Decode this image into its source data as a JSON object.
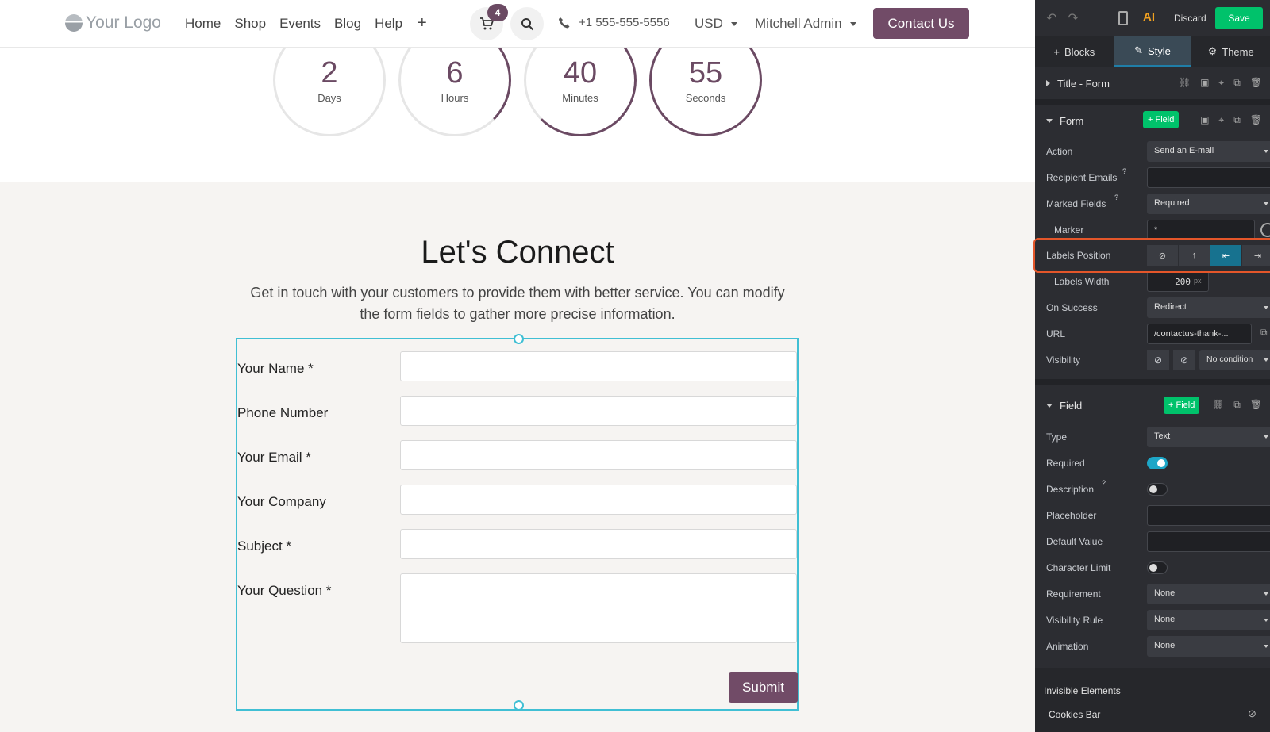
{
  "nav": {
    "logo": "Your Logo",
    "links": [
      "Home",
      "Shop",
      "Events",
      "Blog",
      "Help"
    ],
    "plus": "+",
    "cart_count": "4",
    "phone": "+1 555-555-5556",
    "currency": "USD",
    "user": "Mitchell Admin",
    "contact": "Contact Us"
  },
  "countdown": [
    {
      "value": "2",
      "unit": "Days"
    },
    {
      "value": "6",
      "unit": "Hours"
    },
    {
      "value": "40",
      "unit": "Minutes"
    },
    {
      "value": "55",
      "unit": "Seconds"
    }
  ],
  "section": {
    "title": "Let's Connect",
    "subtitle": "Get in touch with your customers to provide them with better service. You can modify the form fields to gather more precise information."
  },
  "form": {
    "fields": [
      "Your Name *",
      "Phone Number",
      "Your Email *",
      "Your Company",
      "Subject *",
      "Your Question *"
    ],
    "submit": "Submit"
  },
  "panel": {
    "discard": "Discard",
    "save": "Save",
    "ai": "AI",
    "tabs": [
      "Blocks",
      "Style",
      "Theme"
    ],
    "title_form": "Title - Form",
    "form_section": "Form",
    "add_field": "+ Field",
    "form_rows": {
      "action_label": "Action",
      "action_value": "Send an E-mail",
      "recipient_label": "Recipient Emails",
      "help": "?",
      "marked_label": "Marked Fields",
      "marked_value": "Required",
      "marker_label": "Marker",
      "marker_value": "*",
      "labels_position_label": "Labels Position",
      "labels_width_label": "Labels Width",
      "labels_width_value": "200",
      "labels_width_unit": "px",
      "on_success_label": "On Success",
      "on_success_value": "Redirect",
      "url_label": "URL",
      "url_value": "/contactus-thank-...",
      "visibility_label": "Visibility",
      "visibility_value": "No condition"
    },
    "field_section": "Field",
    "field_rows": {
      "type_label": "Type",
      "type_value": "Text",
      "required_label": "Required",
      "description_label": "Description",
      "placeholder_label": "Placeholder",
      "default_label": "Default Value",
      "char_limit_label": "Character Limit",
      "requirement_label": "Requirement",
      "requirement_value": "None",
      "vis_rule_label": "Visibility Rule",
      "vis_rule_value": "None",
      "animation_label": "Animation",
      "animation_value": "None"
    },
    "invisible_title": "Invisible Elements",
    "cookies": "Cookies Bar"
  }
}
